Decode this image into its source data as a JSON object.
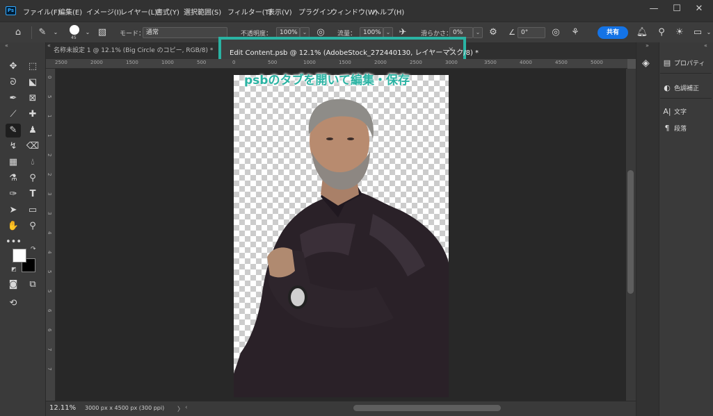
{
  "app": {
    "logo": "Ps"
  },
  "menu": [
    "ファイル(F)",
    "編集(E)",
    "イメージ(I)",
    "レイヤー(L)",
    "書式(Y)",
    "選択範囲(S)",
    "フィルター(T)",
    "表示(V)",
    "プラグイン",
    "ウィンドウ(W)",
    "ヘルプ(H)"
  ],
  "window_controls": {
    "minimize": "—",
    "maximize": "☐",
    "close": "✕"
  },
  "options": {
    "brush_size": "45",
    "mode_label": "モード：",
    "mode_value": "通常",
    "opacity_label": "不透明度：",
    "opacity_value": "100%",
    "flow_label": "流量：",
    "flow_value": "100%",
    "smoothing_label": "滑らかさ：",
    "smoothing_value": "0%",
    "angle_value": "0°",
    "share_label": "共有"
  },
  "tabs": [
    {
      "label": "名称未設定 1 @ 12.1% (Big Circle のコピー, RGB/8) *",
      "active": false
    },
    {
      "label": "Edit Content.psb @ 12.1% (AdobeStock_272440130, レイヤーマスク/8) *",
      "active": true
    }
  ],
  "tab_close": "×",
  "ruler_h": [
    "2500",
    "2000",
    "1500",
    "1000",
    "500",
    "0",
    "500",
    "1000",
    "1500",
    "2000",
    "2500",
    "3000",
    "3500",
    "4000",
    "4500",
    "5000"
  ],
  "ruler_v": [
    "0",
    "5",
    "1",
    "1",
    "2",
    "2",
    "3",
    "3",
    "4",
    "4",
    "5",
    "5",
    "6",
    "6",
    "7",
    "7"
  ],
  "annotation": "psbのタブを開いて編集・保存",
  "status": {
    "zoom": "12.11%",
    "doc_info": "3000 px x 4500 px (300 ppi)",
    "arrow": "〉"
  },
  "panels": [
    {
      "label": "プロパティ",
      "icon": "properties-icon"
    },
    {
      "label": "色調補正",
      "icon": "adjustments-icon"
    },
    {
      "label": "文字",
      "icon": "character-icon"
    },
    {
      "label": "段落",
      "icon": "paragraph-icon"
    }
  ],
  "colors": {
    "accent": "#2ab3a3",
    "share": "#1473e6",
    "foreground_swatch": "#ffffff",
    "background_swatch": "#000000"
  }
}
